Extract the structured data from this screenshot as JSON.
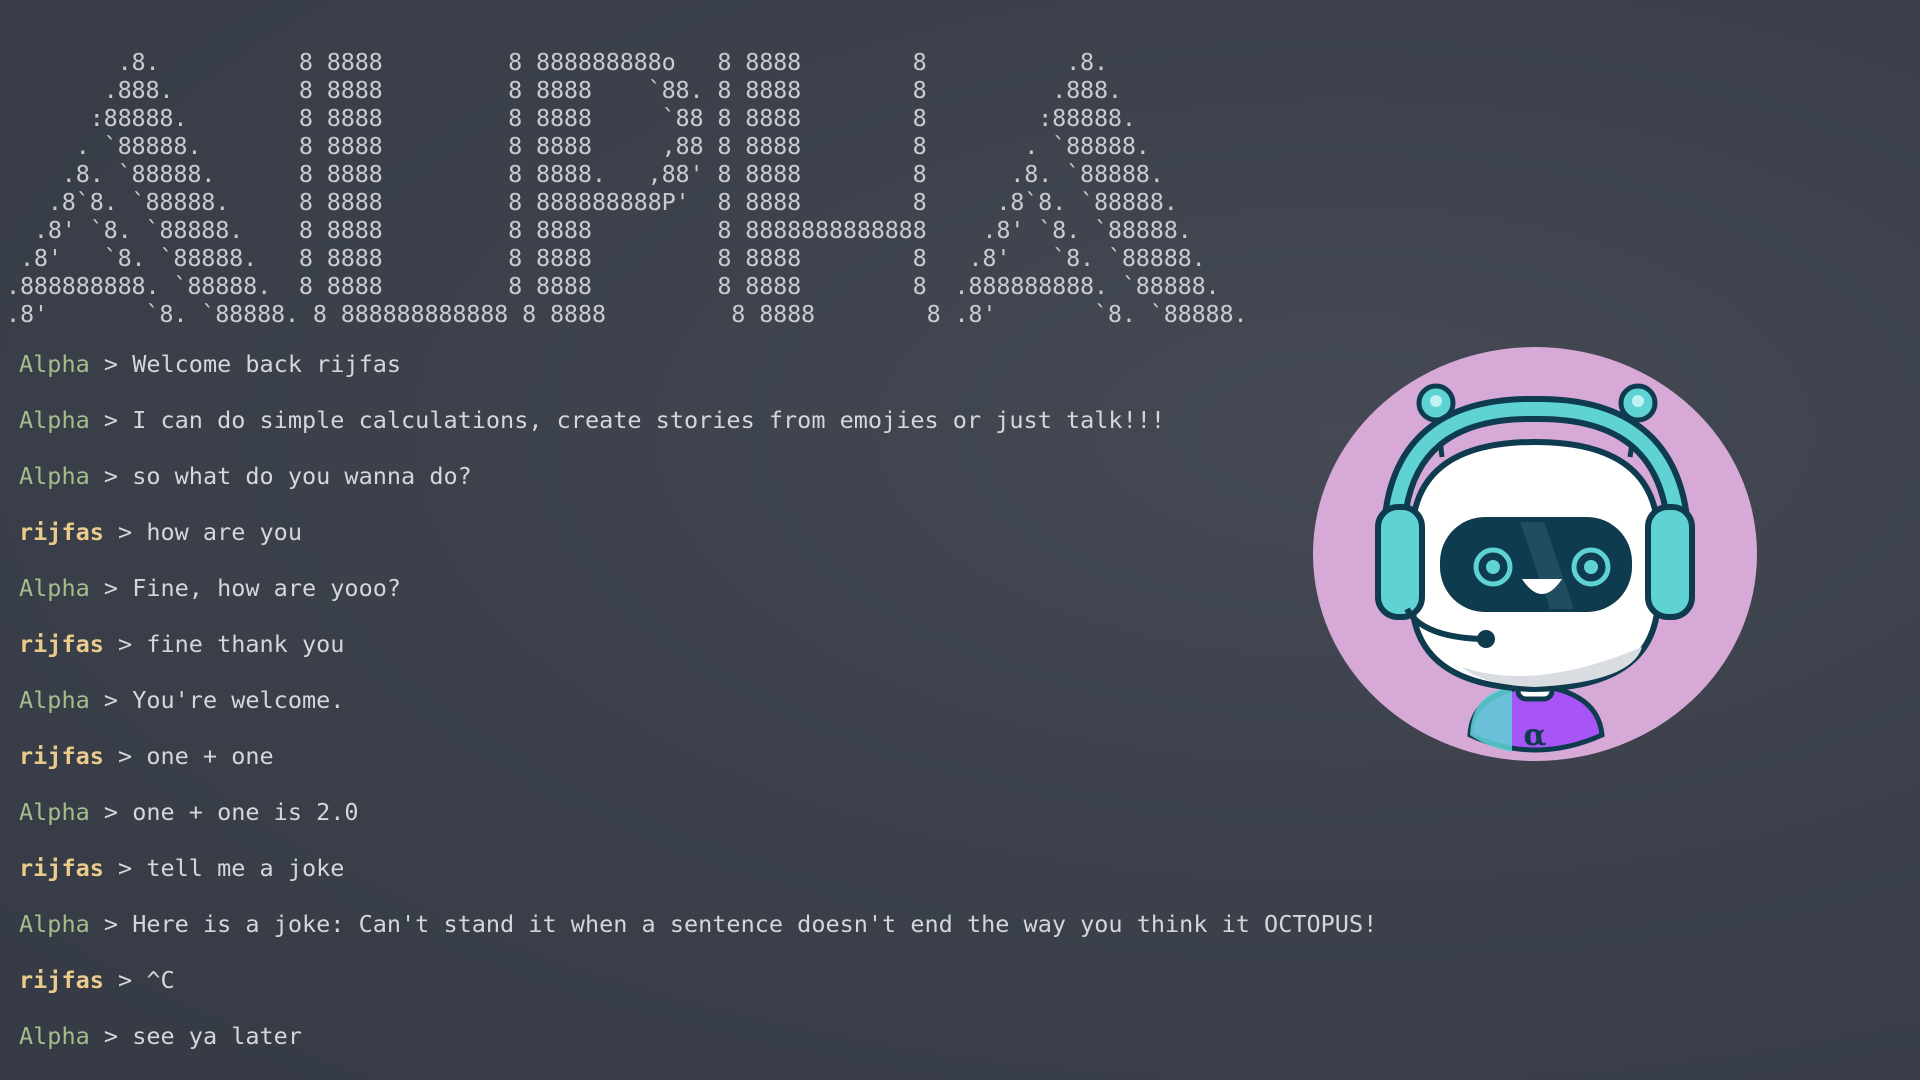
{
  "banner": {
    "lines": [
      "        .8.          8 8888         8 888888888o   8 8888        8          .8.",
      "       .888.         8 8888         8 8888    `88. 8 8888        8         .888.",
      "      :88888.        8 8888         8 8888     `88 8 8888        8        :88888.",
      "     . `88888.       8 8888         8 8888     ,88 8 8888        8       . `88888.",
      "    .8. `88888.      8 8888         8 8888.   ,88' 8 8888        8      .8. `88888.",
      "   .8`8. `88888.     8 8888         8 888888888P'  8 8888        8     .8`8. `88888.",
      "  .8' `8. `88888.    8 8888         8 8888         8 8888888888888    .8' `8. `88888.",
      " .8'   `8. `88888.   8 8888         8 8888         8 8888        8   .8'   `8. `88888.",
      ".888888888. `88888.  8 8888         8 8888         8 8888        8  .888888888. `88888.",
      ".8'       `8. `88888. 8 888888888888 8 8888         8 8888        8 .8'       `8. `88888."
    ]
  },
  "chat": [
    {
      "speaker": "Alpha",
      "role": "bot",
      "text": "Welcome back rijfas"
    },
    {
      "speaker": "Alpha",
      "role": "bot",
      "text": "I can do simple calculations, create stories from emojies or just talk!!!"
    },
    {
      "speaker": "Alpha",
      "role": "bot",
      "text": "so what do you wanna do?"
    },
    {
      "speaker": "rijfas",
      "role": "user",
      "text": "how are you"
    },
    {
      "speaker": "Alpha",
      "role": "bot",
      "text": "Fine, how are yooo?"
    },
    {
      "speaker": "rijfas",
      "role": "user",
      "text": "fine thank you"
    },
    {
      "speaker": "Alpha",
      "role": "bot",
      "text": "You're welcome."
    },
    {
      "speaker": "rijfas",
      "role": "user",
      "text": "one + one"
    },
    {
      "speaker": "Alpha",
      "role": "bot",
      "text": "one + one is 2.0"
    },
    {
      "speaker": "rijfas",
      "role": "user",
      "text": "tell me a joke"
    },
    {
      "speaker": "Alpha",
      "role": "bot",
      "text": "Here is a joke: Can't stand it when a sentence doesn't end the way you think it OCTOPUS!"
    },
    {
      "speaker": "rijfas",
      "role": "user",
      "text": "^C"
    },
    {
      "speaker": "Alpha",
      "role": "bot",
      "text": "see ya later"
    }
  ],
  "prompt_separator": " > ",
  "avatar": {
    "icon": "robot-mascot-icon",
    "emblem": "α",
    "colors": {
      "background": "#d6a9d6",
      "accent": "#5fd3d3",
      "outline": "#0f3b4f",
      "shirt": "#a855f7"
    }
  },
  "colors": {
    "bot_name": "#a3be8c",
    "user_name": "#ebcb8b",
    "text": "#d4d6da"
  }
}
